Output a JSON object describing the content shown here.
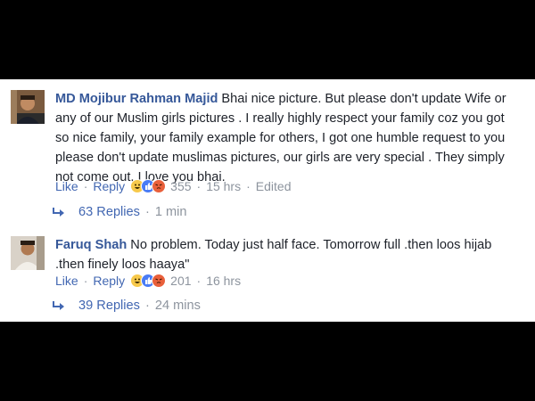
{
  "comments": [
    {
      "author": "MD Mojibur Rahman Majid",
      "text": "Bhai nice picture. But please don't update Wife or any of our Muslim girls pictures . I really highly respect your family coz you got so nice family, your family example for others, I got one humble request to you please don't update muslimas pictures, our girls are very special . They simply not come out, I love you bhai.",
      "like_label": "Like",
      "reply_label": "Reply",
      "reaction_count": "355",
      "time": "15 hrs",
      "edited_label": "Edited",
      "replies_label": "63 Replies",
      "replies_time": "1 min"
    },
    {
      "author": "Faruq Shah",
      "text": "No problem. Today just half face. Tomorrow full .then loos hijab .then finely loos haaya\"",
      "like_label": "Like",
      "reply_label": "Reply",
      "reaction_count": "201",
      "time": "16 hrs",
      "replies_label": "39 Replies",
      "replies_time": "24 mins"
    }
  ],
  "icons": {
    "reactions": [
      "haha-icon",
      "like-icon",
      "angry-icon"
    ],
    "reply": "reply-arrow-icon"
  },
  "colors": {
    "author": "#365899",
    "link": "#4267b2",
    "meta": "#8d949e",
    "text": "#1d2129"
  }
}
